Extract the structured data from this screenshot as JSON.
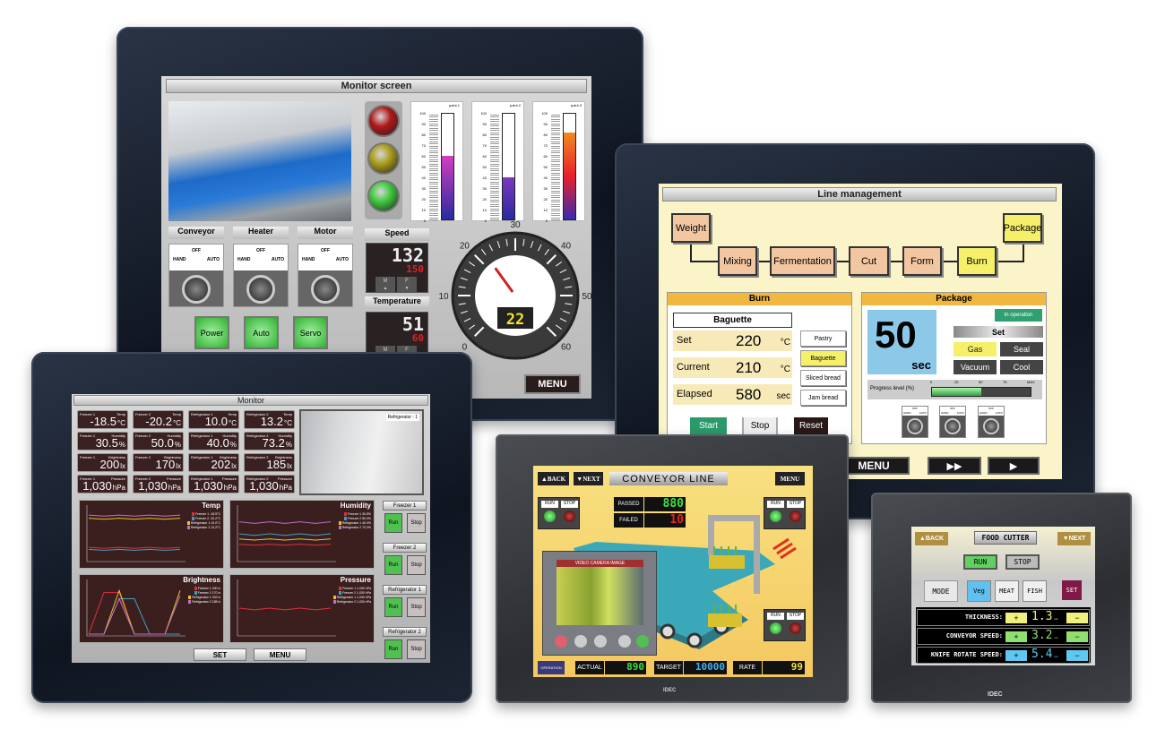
{
  "monitor_screen": {
    "title": "Monitor screen",
    "bars": [
      {
        "label": "point.1",
        "value": 60,
        "colors": [
          "#2a2aa0",
          "#d040c0"
        ]
      },
      {
        "label": "point.2",
        "value": 40,
        "colors": [
          "#2a2aa0",
          "#7a3ac0"
        ]
      },
      {
        "label": "point.3",
        "value": 82,
        "colors": [
          "#3a2ab0",
          "#e8202a",
          "#f08a20"
        ]
      }
    ],
    "bar_ticks": [
      "100",
      "90",
      "80",
      "70",
      "60",
      "50",
      "40",
      "30",
      "20",
      "10",
      "0"
    ],
    "switches": [
      {
        "label": "Conveyor",
        "off": "OFF",
        "hand": "HAND",
        "auto": "AUTO"
      },
      {
        "label": "Heater",
        "off": "OFF",
        "hand": "HAND",
        "auto": "AUTO"
      },
      {
        "label": "Motor",
        "off": "OFF",
        "hand": "HAND",
        "auto": "AUTO"
      }
    ],
    "buttons": [
      "Power",
      "Auto",
      "Servo"
    ],
    "speed": {
      "label": "Speed",
      "value": "132",
      "setpoint": "150",
      "m": "M",
      "f": "F"
    },
    "temperature": {
      "label": "Temperature",
      "value": "51",
      "setpoint": "60",
      "m": "M",
      "f": "F"
    },
    "gauge": {
      "ticks": [
        "0",
        "10",
        "20",
        "30",
        "40",
        "50",
        "60"
      ],
      "value": 22,
      "readout": "22"
    },
    "menu": "MENU",
    "lights": [
      "#b01818",
      "#a89a18",
      "#3cc83c"
    ]
  },
  "line_management": {
    "title": "Line management",
    "flow": [
      "Weight",
      "Mixing",
      "Fermentation",
      "Cut",
      "Form",
      "Burn",
      "Package"
    ],
    "burn": {
      "title": "Burn",
      "product": "Baguette",
      "rows": [
        {
          "label": "Set",
          "value": "220",
          "unit": "°C"
        },
        {
          "label": "Current",
          "value": "210",
          "unit": "°C"
        },
        {
          "label": "Elapsed",
          "value": "580",
          "unit": "sec"
        }
      ],
      "options": [
        "Pastry",
        "Baguette",
        "Sliced bread",
        "Jam bread"
      ],
      "selected": "Baguette",
      "start": "Start",
      "stop": "Stop",
      "reset": "Reset"
    },
    "package": {
      "title": "Package",
      "timer": "50",
      "timer_unit": "sec",
      "status": "In operation",
      "set": "Set",
      "modes": [
        "Gas",
        "Seal",
        "Vacuum",
        "Cool"
      ],
      "progress_label": "Progress level (%)",
      "progress_ticks": [
        "0",
        "25",
        "50",
        "75",
        "MAX"
      ],
      "progress": 50,
      "knob": {
        "off": "OFF",
        "hand": "HAND",
        "auto": "AUTO"
      }
    },
    "nav": {
      "menu": "MENU",
      "fast_forward": "▶▶",
      "play": "▶"
    }
  },
  "monitor": {
    "title": "Monitor",
    "cards": [
      [
        {
          "l": "Freezer 1",
          "m": "Temp",
          "v": "-18.5",
          "u": "°C"
        },
        {
          "l": "Freezer 2",
          "m": "Temp",
          "v": "-20.2",
          "u": "°C"
        },
        {
          "l": "Refrigerator 1",
          "m": "Temp",
          "v": "10.0",
          "u": "°C"
        },
        {
          "l": "Refrigerator 2",
          "m": "Temp",
          "v": "13.2",
          "u": "°C"
        }
      ],
      [
        {
          "l": "Freezer 1",
          "m": "Humidity",
          "v": "30.5",
          "u": "%"
        },
        {
          "l": "Freezer 2",
          "m": "Humidity",
          "v": "50.0",
          "u": "%"
        },
        {
          "l": "Refrigerator 1",
          "m": "Humidity",
          "v": "40.0",
          "u": "%"
        },
        {
          "l": "Refrigerator 2",
          "m": "Humidity",
          "v": "73.2",
          "u": "%"
        }
      ],
      [
        {
          "l": "Freezer 1",
          "m": "Brightness",
          "v": "200",
          "u": "lx"
        },
        {
          "l": "Freezer 2",
          "m": "Brightness",
          "v": "170",
          "u": "lx"
        },
        {
          "l": "Refrigerator 1",
          "m": "Brightness",
          "v": "202",
          "u": "lx"
        },
        {
          "l": "Refrigerator 2",
          "m": "Brightness",
          "v": "185",
          "u": "lx"
        }
      ],
      [
        {
          "l": "Freezer 1",
          "m": "Pressure",
          "v": "1,030",
          "u": "hPa"
        },
        {
          "l": "Freezer 2",
          "m": "Pressure",
          "v": "1,030",
          "u": "hPa"
        },
        {
          "l": "Refrigerator 1",
          "m": "Pressure",
          "v": "1,030",
          "u": "hPa"
        },
        {
          "l": "Refrigerator 2",
          "m": "Pressure",
          "v": "1,030",
          "u": "hPa"
        }
      ]
    ],
    "camera_label": "Refrigerator : 1",
    "series_colors": [
      "#e03040",
      "#40a0c0",
      "#e8c030",
      "#c070c0"
    ],
    "charts": [
      {
        "title": "Temp",
        "legend": [
          "Freezer 1 -18.5°C",
          "Freezer 2 -20.2°C",
          "Refrigerator 1 10.0°C",
          "Refrigerator 2 13.2°C"
        ],
        "range": [
          -30,
          20
        ],
        "series": [
          [
            -18,
            -19,
            -18,
            -19,
            -18,
            -19,
            -18
          ],
          [
            -20,
            -21,
            -20,
            -21,
            -20,
            -21,
            -20
          ],
          [
            10,
            9,
            10,
            9,
            10,
            9,
            10
          ],
          [
            13,
            12,
            13,
            12,
            13,
            12,
            13
          ]
        ]
      },
      {
        "title": "Humidity",
        "legend": [
          "Freezer 1 30.5%",
          "Freezer 2 50.0%",
          "Refrigerator 1 40.0%",
          "Refrigerator 2 73.2%"
        ],
        "range": [
          0,
          100
        ],
        "series": [
          [
            30,
            28,
            30,
            28,
            30,
            28,
            30
          ],
          [
            50,
            47,
            50,
            47,
            50,
            47,
            50
          ],
          [
            40,
            38,
            40,
            38,
            40,
            38,
            40
          ],
          [
            73,
            70,
            73,
            70,
            73,
            70,
            73
          ]
        ]
      },
      {
        "title": "Brightness",
        "legend": [
          "Freezer 1 200 lx",
          "Freezer 2 170 lx",
          "Refrigerator 1 202 lx",
          "Refrigerator 2 185 lx"
        ],
        "range": [
          0,
          250
        ],
        "series": [
          [
            0,
            200,
            200,
            0,
            0,
            0,
            0
          ],
          [
            0,
            0,
            170,
            170,
            0,
            0,
            0
          ],
          [
            0,
            0,
            210,
            0,
            0,
            0,
            210
          ],
          [
            0,
            0,
            170,
            0,
            0,
            0,
            185
          ]
        ]
      },
      {
        "title": "Pressure",
        "legend": [
          "Freezer 1 1,030 hPa",
          "Freezer 2 1,030 hPa",
          "Refrigerator 1 1,030 hPa",
          "Refrigerator 2 1,030 hPa"
        ],
        "range": [
          1000,
          1060
        ],
        "series": [
          [
            1030,
            1028,
            1030,
            1028,
            1030,
            1028,
            1030
          ]
        ]
      }
    ],
    "controls": [
      {
        "label": "Freezer 1",
        "run": "Run",
        "stop": "Stop"
      },
      {
        "label": "Freezer 2",
        "run": "Run",
        "stop": "Stop"
      },
      {
        "label": "Refrigerator 1",
        "run": "Run",
        "stop": "Stop"
      },
      {
        "label": "Refrigerator 2",
        "run": "Run",
        "stop": "Stop"
      }
    ],
    "set": "SET",
    "menu": "MENU"
  },
  "conveyor": {
    "back": "▲BACK",
    "next": "▼NEXT",
    "title": "CONVEYOR LINE",
    "menu": "MENU",
    "run": "RUN",
    "stop": "STOP",
    "passed_label": "PASSED",
    "passed": "880",
    "failed_label": "FAILED",
    "failed": "10",
    "video_label": "VIDEO CAMERA IMAGE",
    "operation": "OPERATION",
    "actual_label": "ACTUAL",
    "actual": "890",
    "target_label": "TARGET",
    "target": "10000",
    "rate_label": "RATE",
    "rate": "99",
    "brand": "IDEC"
  },
  "food_cutter": {
    "back": "▲BACK",
    "title": "FOOD CUTTER",
    "next": "▼NEXT",
    "run": "RUN",
    "stop": "STOP",
    "mode": "MODE",
    "modes": [
      "Veg",
      "MEAT",
      "FISH"
    ],
    "selected_mode": "Veg",
    "set": "SET",
    "rows": [
      {
        "label": "THICKNESS:",
        "value": "1.3",
        "unit": "mm",
        "color": "#f0f080"
      },
      {
        "label": "CONVEYOR SPEED:",
        "value": "3.2",
        "unit": "m/s",
        "color": "#90e070"
      },
      {
        "label": "KNIFE ROTATE SPEED:",
        "value": "5.4",
        "unit": "rpm",
        "color": "#60c8f0"
      }
    ],
    "plus": "+",
    "minus": "−",
    "brand": "IDEC"
  }
}
